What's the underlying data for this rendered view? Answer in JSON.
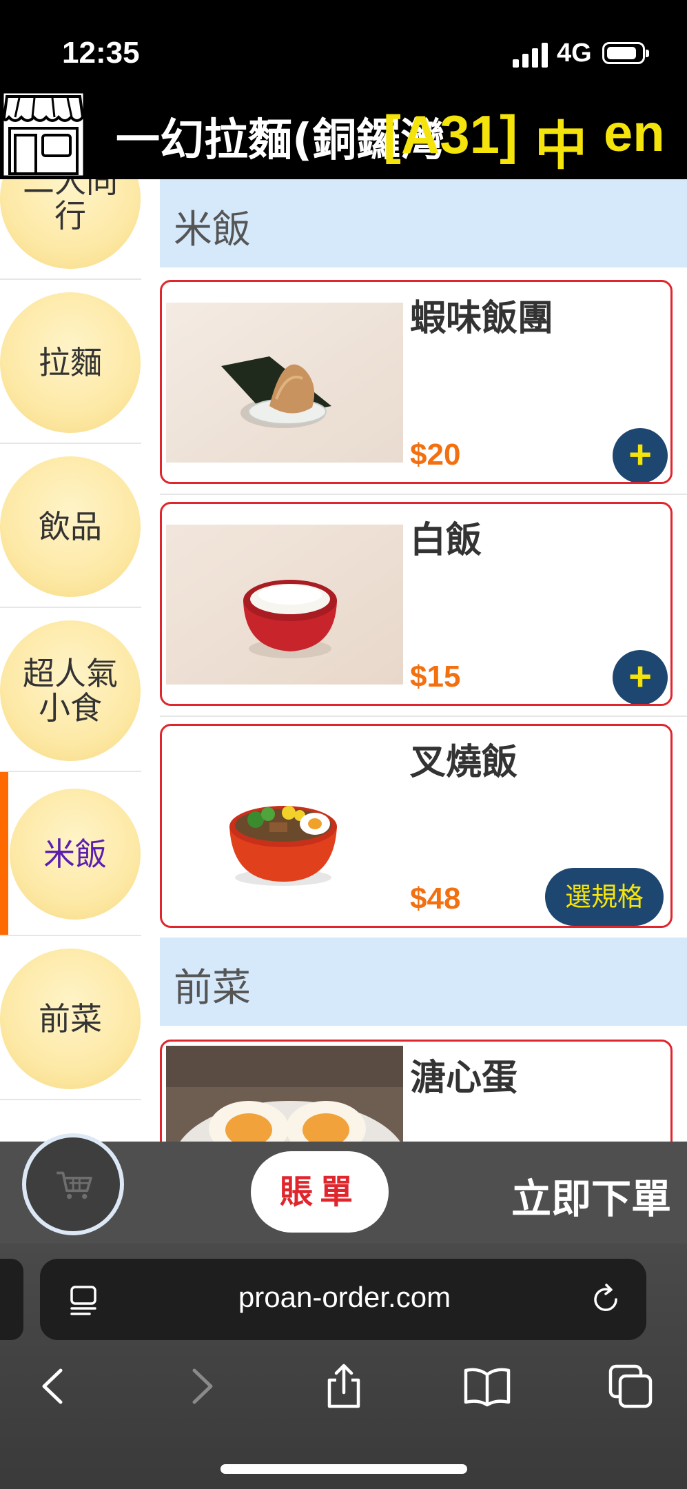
{
  "status_bar": {
    "time": "12:35",
    "network": "4G"
  },
  "header": {
    "store_name": "一幻拉麵(銅鑼灣",
    "table_code": "[A31]",
    "lang_zh": "中",
    "lang_en": "en",
    "store_icon": "store-icon"
  },
  "sidebar": {
    "items": [
      {
        "label": "二人同\n行",
        "active": false
      },
      {
        "label": "拉麵",
        "active": false
      },
      {
        "label": "飲品",
        "active": false
      },
      {
        "label": "超人氣\n小食",
        "active": false
      },
      {
        "label": "米飯",
        "active": true
      },
      {
        "label": "前菜",
        "active": false
      }
    ],
    "active_color": "#5a1fb0",
    "marker_color": "#ff6a00"
  },
  "menu": {
    "sections": [
      {
        "title": "米飯"
      },
      {
        "title": "前菜"
      }
    ],
    "items": [
      {
        "name": "蝦味飯團",
        "price": "$20",
        "action": "+",
        "photo": "rice-ball-photo"
      },
      {
        "name": "白飯",
        "price": "$15",
        "action": "+",
        "photo": "white-rice-photo"
      },
      {
        "name": "叉燒飯",
        "price": "$48",
        "action": "選規格",
        "photo": "char-siu-rice-photo"
      },
      {
        "name": "溏心蛋",
        "price": "",
        "action": "",
        "photo": "soft-egg-photo"
      }
    ],
    "price_color": "#f27010",
    "button_color": "#1d4670"
  },
  "order_bar": {
    "cart_icon": "cart-icon",
    "bill_label": "賬單",
    "order_label": "立即下單"
  },
  "browser": {
    "url": "proan-order.com",
    "nav": [
      "back-icon",
      "forward-icon",
      "share-icon",
      "bookmarks-icon",
      "tabs-icon"
    ]
  }
}
